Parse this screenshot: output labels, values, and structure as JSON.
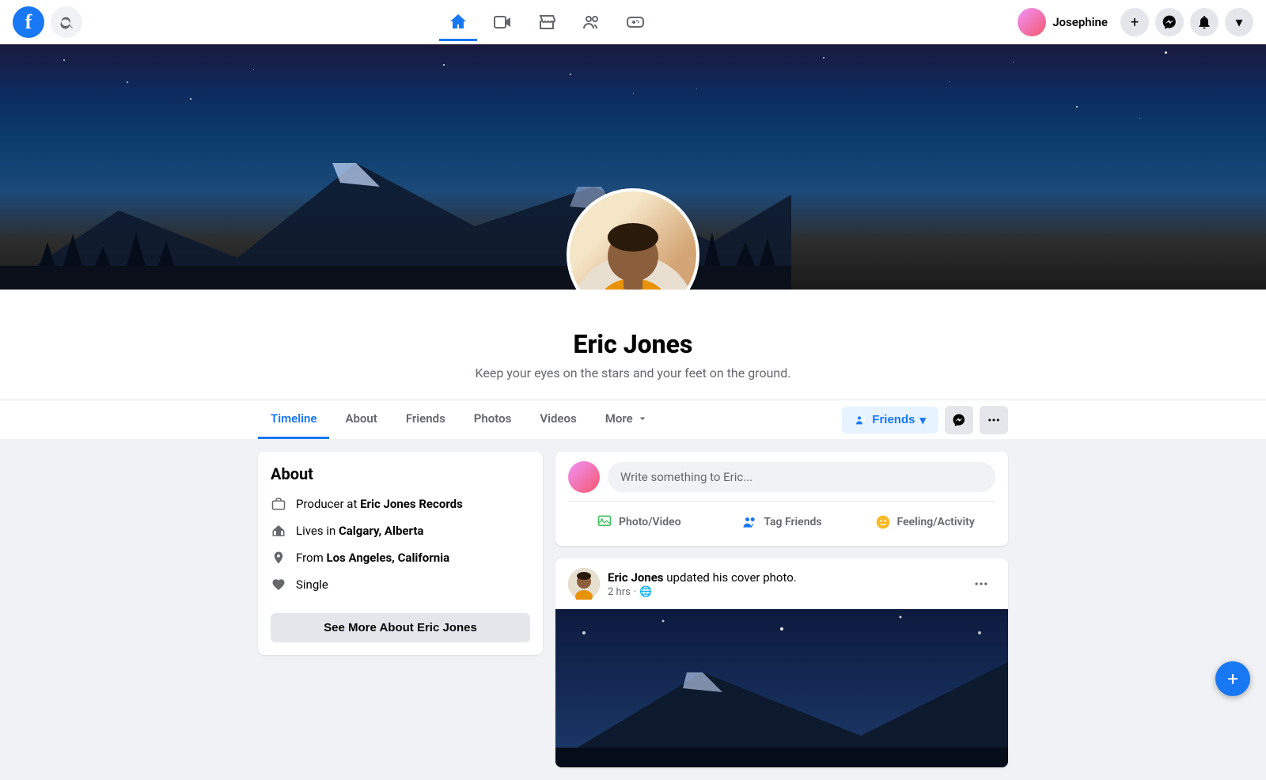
{
  "navbar": {
    "logo_letter": "f",
    "user": {
      "name": "Josephine",
      "avatar_alt": "Josephine avatar"
    },
    "actions": {
      "plus": "+",
      "messenger": "💬",
      "bell": "🔔",
      "dropdown": "▼"
    },
    "nav_icons": [
      "home",
      "video",
      "store",
      "groups",
      "gaming"
    ]
  },
  "profile": {
    "name": "Eric Jones",
    "bio": "Keep your eyes on the stars and your feet on the ground.",
    "cover_alt": "Mountain night sky cover photo"
  },
  "tabs": {
    "items": [
      {
        "label": "Timeline",
        "active": true
      },
      {
        "label": "About",
        "active": false
      },
      {
        "label": "Friends",
        "active": false
      },
      {
        "label": "Photos",
        "active": false
      },
      {
        "label": "Videos",
        "active": false
      },
      {
        "label": "More",
        "active": false
      }
    ],
    "actions": {
      "friends_label": "Friends",
      "friends_dropdown": "▾"
    }
  },
  "about": {
    "title": "About",
    "items": [
      {
        "icon": "briefcase",
        "text": "Producer at ",
        "highlight": "Eric Jones Records"
      },
      {
        "icon": "home",
        "text": "Lives in ",
        "highlight": "Calgary, Alberta"
      },
      {
        "icon": "location",
        "text": "From ",
        "highlight": "Los Angeles, California"
      },
      {
        "icon": "heart",
        "text": "Single",
        "highlight": ""
      }
    ],
    "see_more_label": "See More About Eric Jones"
  },
  "write_post": {
    "placeholder": "Write something to Eric...",
    "actions": [
      {
        "label": "Photo/Video",
        "color": "#45bd62"
      },
      {
        "label": "Tag Friends",
        "color": "#1877f2"
      },
      {
        "label": "Feeling/Activity",
        "color": "#f7b928"
      }
    ]
  },
  "activity": {
    "user": "Eric Jones",
    "action": " updated his cover photo.",
    "time": "2 hrs",
    "privacy": "🌐"
  }
}
